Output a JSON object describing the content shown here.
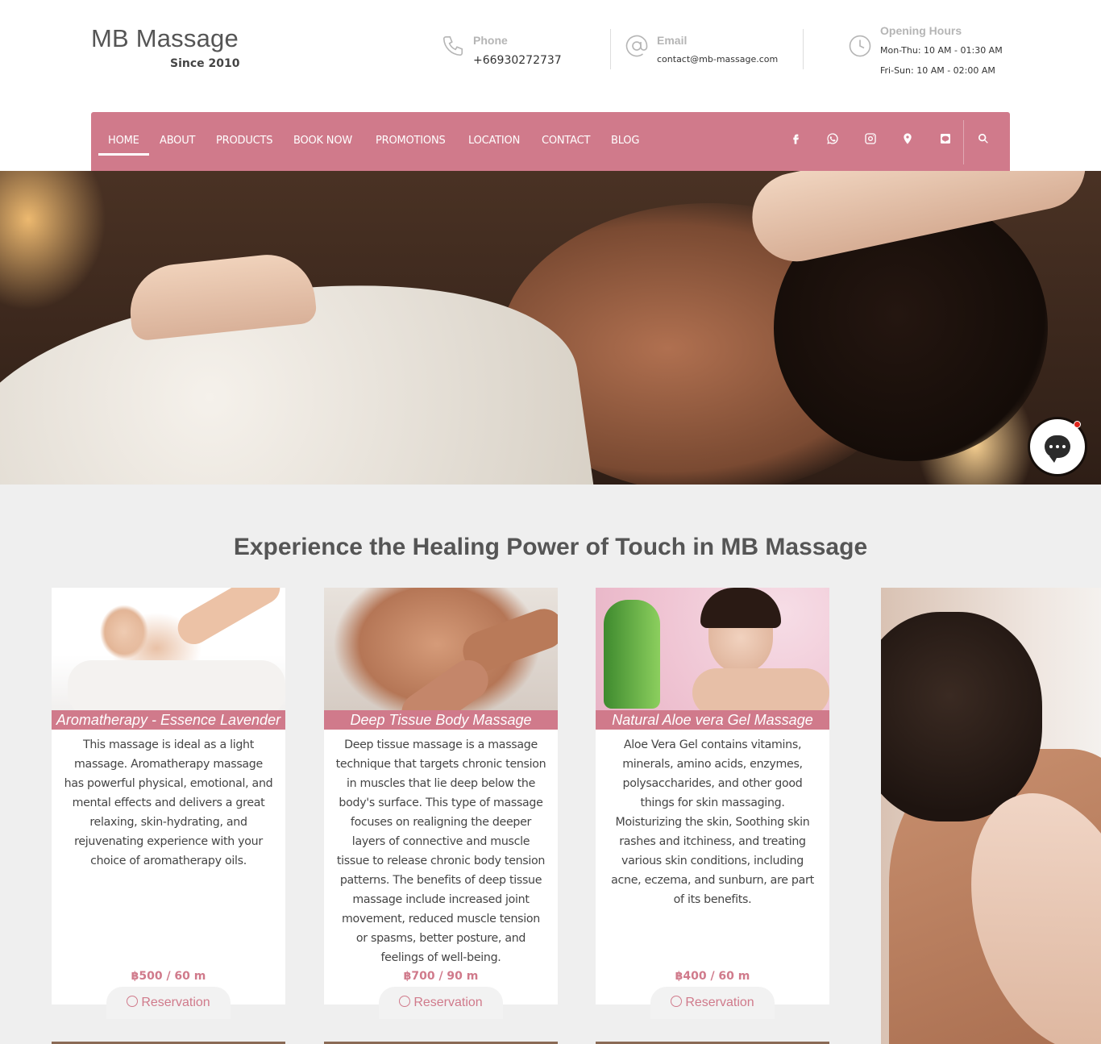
{
  "brand": {
    "name": "MB Massage",
    "since": "Since 2010"
  },
  "contact": {
    "phone_label": "Phone",
    "phone_value": "+66930272737",
    "email_label": "Email",
    "email_value": "contact@mb-massage.com",
    "hours_label": "Opening Hours",
    "hours_line1": "Mon-Thu: 10 AM - 01:30 AM",
    "hours_line2": "Fri-Sun: 10 AM - 02:00 AM"
  },
  "nav": {
    "items": [
      "HOME",
      "ABOUT",
      "PRODUCTS",
      "BOOK NOW",
      "PROMOTIONS",
      "LOCATION",
      "CONTACT",
      "BLOG"
    ],
    "active": "HOME",
    "social_icons": [
      "facebook-icon",
      "whatsapp-icon",
      "instagram-icon",
      "map-pin-icon",
      "line-icon",
      "search-icon"
    ]
  },
  "colors": {
    "accent": "#d07a8b",
    "background": "#efefef"
  },
  "section": {
    "title": "Experience the Healing Power of Touch in MB Massage"
  },
  "cards": [
    {
      "title": "Aromatherapy - Essence Lavender",
      "description": "This massage is ideal as a light massage. Aromatherapy massage has powerful physical, emotional, and mental effects and delivers a great relaxing, skin-hydrating, and rejuvenating experience with your choice of aromatherapy oils.",
      "price": "฿500 / 60 m",
      "button": "Reservation"
    },
    {
      "title": "Deep Tissue Body Massage",
      "description": "Deep tissue massage is a massage technique that targets chronic tension in muscles that lie deep below the body's surface. This type of massage focuses on realigning the deeper layers of connective and muscle tissue to release chronic body tension patterns. The benefits of deep tissue massage include increased joint movement, reduced muscle tension or spasms, better posture, and feelings of well-being.",
      "price": "฿700 / 90 m",
      "button": "Reservation"
    },
    {
      "title": "Natural Aloe vera Gel Massage",
      "description": "Aloe Vera Gel contains vitamins, minerals, amino acids, enzymes, polysaccharides, and other good things for skin massaging. Moisturizing the skin, Soothing skin rashes and itchiness, and treating various skin conditions, including acne, eczema, and sunburn, are part of its benefits.",
      "price": "฿400 / 60 m",
      "button": "Reservation"
    }
  ]
}
